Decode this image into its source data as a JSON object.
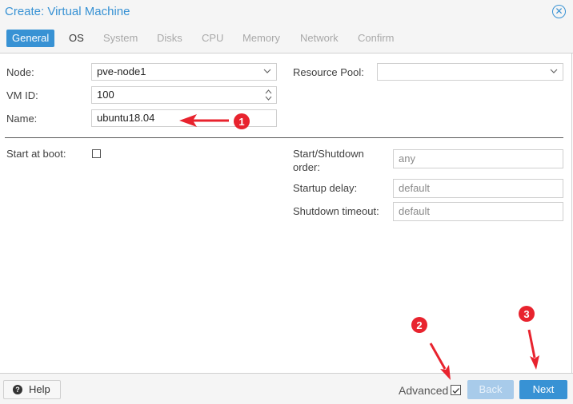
{
  "window": {
    "title": "Create: Virtual Machine"
  },
  "tabs": [
    {
      "label": "General",
      "state": "active"
    },
    {
      "label": "OS",
      "state": "enabled"
    },
    {
      "label": "System",
      "state": "disabled"
    },
    {
      "label": "Disks",
      "state": "disabled"
    },
    {
      "label": "CPU",
      "state": "disabled"
    },
    {
      "label": "Memory",
      "state": "disabled"
    },
    {
      "label": "Network",
      "state": "disabled"
    },
    {
      "label": "Confirm",
      "state": "disabled"
    }
  ],
  "form": {
    "node": {
      "label": "Node:",
      "value": "pve-node1"
    },
    "vmid": {
      "label": "VM ID:",
      "value": "100"
    },
    "name": {
      "label": "Name:",
      "value": "ubuntu18.04"
    },
    "resource_pool": {
      "label": "Resource Pool:",
      "value": ""
    },
    "start_at_boot": {
      "label": "Start at boot:",
      "checked": false
    },
    "start_shutdown_order": {
      "label_line1": "Start/Shutdown",
      "label_line2": "order:",
      "placeholder": "any"
    },
    "startup_delay": {
      "label": "Startup delay:",
      "placeholder": "default"
    },
    "shutdown_timeout": {
      "label": "Shutdown timeout:",
      "placeholder": "default"
    }
  },
  "footer": {
    "help_label": "Help",
    "advanced_label": "Advanced",
    "advanced_checked": true,
    "back_label": "Back",
    "next_label": "Next"
  },
  "annotations": [
    {
      "number": "1"
    },
    {
      "number": "2"
    },
    {
      "number": "3"
    }
  ],
  "colors": {
    "accent": "#3892d4",
    "annotation": "#e8232e",
    "disabled_button": "#a8cbea"
  }
}
